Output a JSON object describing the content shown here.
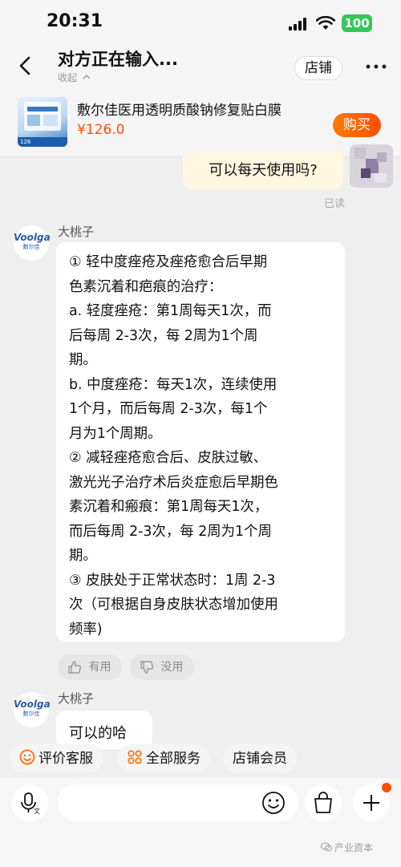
{
  "status_bar": {
    "time": "20:31",
    "battery": "100"
  },
  "header": {
    "title": "对方正在输入...",
    "collapse_label": "收起",
    "store_button": "店铺"
  },
  "product": {
    "name": "敷尔佳医用透明质酸钠修复贴白膜",
    "price": "¥126.0",
    "buy_button": "购买",
    "thumb_label": "126"
  },
  "outgoing": {
    "text": "可以每天使用吗?",
    "read_status": "已读"
  },
  "avatar_brand": {
    "logo": "Voolga",
    "name_cn": "敷尔佳"
  },
  "messages": [
    {
      "sender": "大桃子",
      "lines": [
        "① 轻中度痤疮及痤疮愈合后早期",
        "色素沉着和疤痕的治疗：",
        "a. 轻度痤疮：第1周每天1次，而",
        "后每周 2-3次，每 2周为1个周",
        "期。",
        "b. 中度痤疮：每天1次，连续使用",
        "1个月，而后每周 2-3次，每1个",
        "月为1个周期。",
        "② 减轻痤疮愈合后、皮肤过敏、",
        "激光光子治疗术后炎症愈后早期色",
        "素沉着和瘢痕：第1周每天1次，",
        "而后每周 2-3次，每 2周为1个周",
        "期。",
        "③ 皮肤处于正常状态时：1周 2-3",
        "次（可根据自身皮肤状态增加使用",
        "频率)"
      ],
      "feedback": {
        "useful": "有用",
        "useless": "没用"
      }
    },
    {
      "sender": "大桃子",
      "text": "可以的哈"
    }
  ],
  "quick_services": [
    "评价客服",
    "全部服务",
    "店铺会员"
  ],
  "watermark": "产业资本"
}
